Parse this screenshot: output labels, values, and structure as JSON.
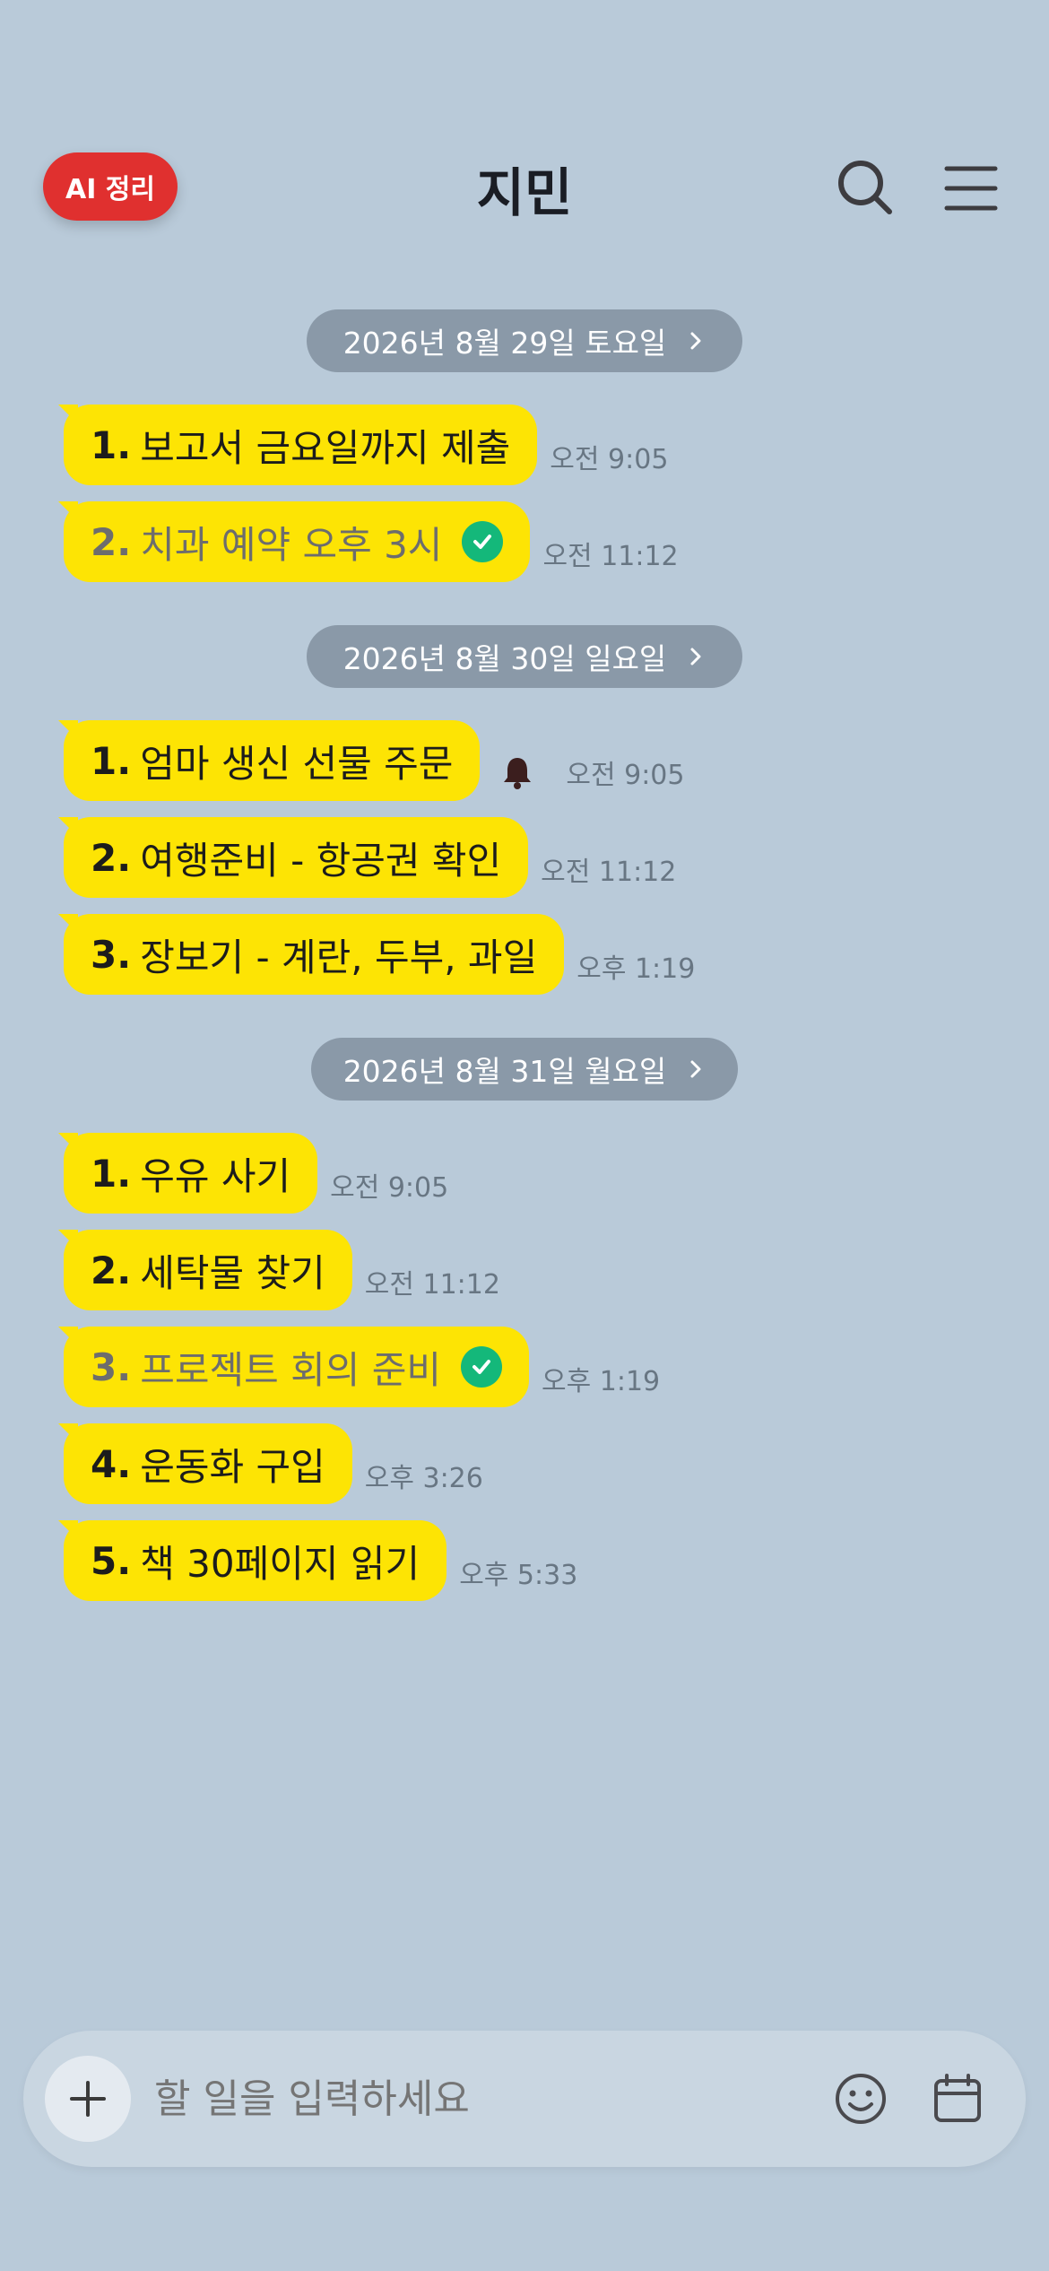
{
  "header": {
    "ai_button": "AI 정리",
    "title": "지민"
  },
  "groups": [
    {
      "date": "2026년 8월 29일 토요일",
      "items": [
        {
          "num": "1.",
          "text": "보고서 금요일까지 제출",
          "time": "오전 9:05",
          "done": false,
          "bell": false
        },
        {
          "num": "2.",
          "text": "치과 예약 오후 3시",
          "time": "오전 11:12",
          "done": true,
          "bell": false
        }
      ]
    },
    {
      "date": "2026년 8월 30일 일요일",
      "items": [
        {
          "num": "1.",
          "text": "엄마 생신 선물 주문",
          "time": "오전 9:05",
          "done": false,
          "bell": true
        },
        {
          "num": "2.",
          "text": "여행준비 - 항공권 확인",
          "time": "오전 11:12",
          "done": false,
          "bell": false
        },
        {
          "num": "3.",
          "text": "장보기 - 계란, 두부, 과일",
          "time": "오후 1:19",
          "done": false,
          "bell": false
        }
      ]
    },
    {
      "date": "2026년 8월 31일 월요일",
      "items": [
        {
          "num": "1.",
          "text": "우유 사기",
          "time": "오전 9:05",
          "done": false,
          "bell": false
        },
        {
          "num": "2.",
          "text": "세탁물 찾기",
          "time": "오전 11:12",
          "done": false,
          "bell": false
        },
        {
          "num": "3.",
          "text": "프로젝트 회의 준비",
          "time": "오후 1:19",
          "done": true,
          "bell": false
        },
        {
          "num": "4.",
          "text": "운동화 구입",
          "time": "오후 3:26",
          "done": false,
          "bell": false
        },
        {
          "num": "5.",
          "text": "책 30페이지 읽기",
          "time": "오후 5:33",
          "done": false,
          "bell": false
        }
      ]
    }
  ],
  "input": {
    "placeholder": "할 일을 입력하세요"
  },
  "colors": {
    "background": "#b9cad9",
    "bubble": "#fde404",
    "ai_button": "#e0302f",
    "check": "#14b87a",
    "date_pill": "#8a99a8"
  }
}
